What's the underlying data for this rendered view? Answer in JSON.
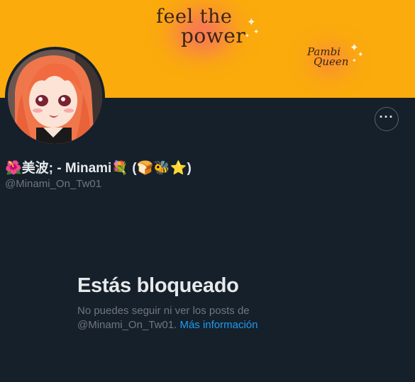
{
  "banner": {
    "line1": "feel the",
    "line2": "power",
    "tag_line1": "Pambi",
    "tag_line2": "Queen",
    "background_color": "#fbab0c"
  },
  "profile": {
    "display_name": "🌺美波; - Minami💐 (🍞🐝⭐)",
    "handle": "@Minami_On_Tw01"
  },
  "more_button": {
    "icon": "more-horizontal-icon",
    "label": "···"
  },
  "blocked": {
    "title": "Estás bloqueado",
    "description_line1": "No puedes seguir ni ver los posts de",
    "description_line2": "@Minami_On_Tw01.",
    "learn_more": "Más información"
  },
  "colors": {
    "background": "#15202b",
    "primary_text": "#e7e9ea",
    "secondary_text": "#71767b",
    "link": "#1d9bf0",
    "border": "#536471"
  }
}
